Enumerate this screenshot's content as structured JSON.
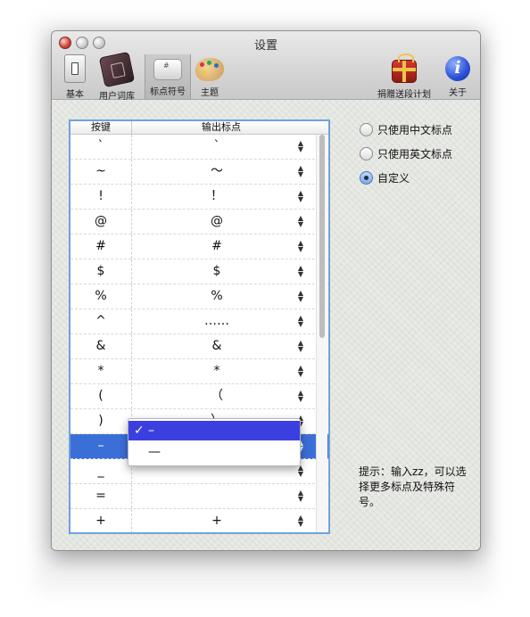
{
  "window": {
    "title": "设置"
  },
  "toolbar": {
    "items": [
      {
        "label": "基本",
        "icon": "switch-icon"
      },
      {
        "label": "用户词库",
        "icon": "book-icon"
      },
      {
        "label": "标点符号",
        "icon": "keyboard-key-icon"
      },
      {
        "label": "主题",
        "icon": "palette-icon"
      },
      {
        "label": "捐赠送段计划",
        "icon": "gift-icon"
      },
      {
        "label": "关于",
        "icon": "info-icon"
      }
    ],
    "selected": "标点符号"
  },
  "table": {
    "headers": {
      "key": "按键",
      "output": "输出标点"
    },
    "rows": [
      {
        "key": "`",
        "output": "`"
      },
      {
        "key": "~",
        "output": "～"
      },
      {
        "key": "!",
        "output": "！"
      },
      {
        "key": "@",
        "output": "@"
      },
      {
        "key": "#",
        "output": "#"
      },
      {
        "key": "$",
        "output": "$"
      },
      {
        "key": "%",
        "output": "%"
      },
      {
        "key": "^",
        "output": "……"
      },
      {
        "key": "&",
        "output": "&"
      },
      {
        "key": "*",
        "output": "*"
      },
      {
        "key": "(",
        "output": "（"
      },
      {
        "key": ")",
        "output": "）"
      },
      {
        "key": "–",
        "output": "–"
      },
      {
        "key": "_",
        "output": ""
      },
      {
        "key": "=",
        "output": ""
      },
      {
        "key": "+",
        "output": "+"
      },
      {
        "key": "[",
        "output": "["
      }
    ],
    "selected_row": 12
  },
  "popup": {
    "selected_option": "–",
    "other_option": "—"
  },
  "options": {
    "only_chinese": "只使用中文标点",
    "only_english": "只使用英文标点",
    "custom": "自定义",
    "selected": "custom"
  },
  "hint": "提示：输入zz，可以选择更多标点及特殊符号。",
  "colors": {
    "selection": "#3b6fd8",
    "table_border": "#6fa2de"
  }
}
